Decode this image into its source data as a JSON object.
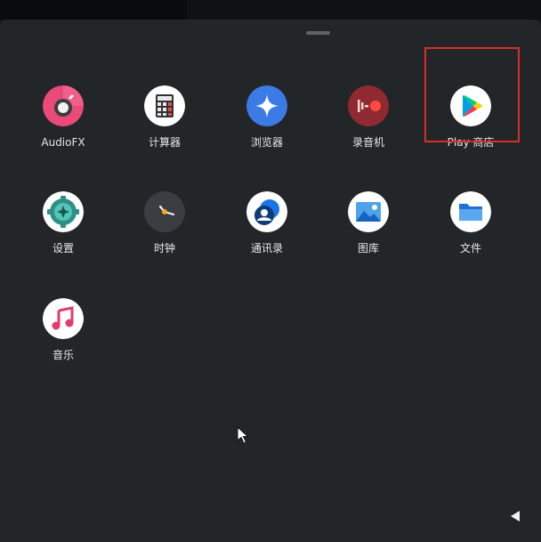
{
  "apps": [
    {
      "id": "audiofx",
      "label": "AudioFX",
      "icon": "audiofx-icon"
    },
    {
      "id": "calculator",
      "label": "计算器",
      "icon": "calculator-icon"
    },
    {
      "id": "browser",
      "label": "浏览器",
      "icon": "browser-icon"
    },
    {
      "id": "recorder",
      "label": "录音机",
      "icon": "recorder-icon"
    },
    {
      "id": "play-store",
      "label": "Play 商店",
      "icon": "play-store-icon",
      "highlighted": true
    },
    {
      "id": "settings",
      "label": "设置",
      "icon": "settings-icon"
    },
    {
      "id": "clock",
      "label": "时钟",
      "icon": "clock-icon"
    },
    {
      "id": "contacts",
      "label": "通讯录",
      "icon": "contacts-icon"
    },
    {
      "id": "gallery",
      "label": "图库",
      "icon": "gallery-icon"
    },
    {
      "id": "files",
      "label": "文件",
      "icon": "files-icon"
    },
    {
      "id": "music",
      "label": "音乐",
      "icon": "music-icon"
    }
  ],
  "colors": {
    "drawer_background": "#232628",
    "highlight_border": "#d92d2d",
    "label_text": "#e6e6e6"
  },
  "navigation": {
    "back_icon": "back-triangle-icon"
  }
}
